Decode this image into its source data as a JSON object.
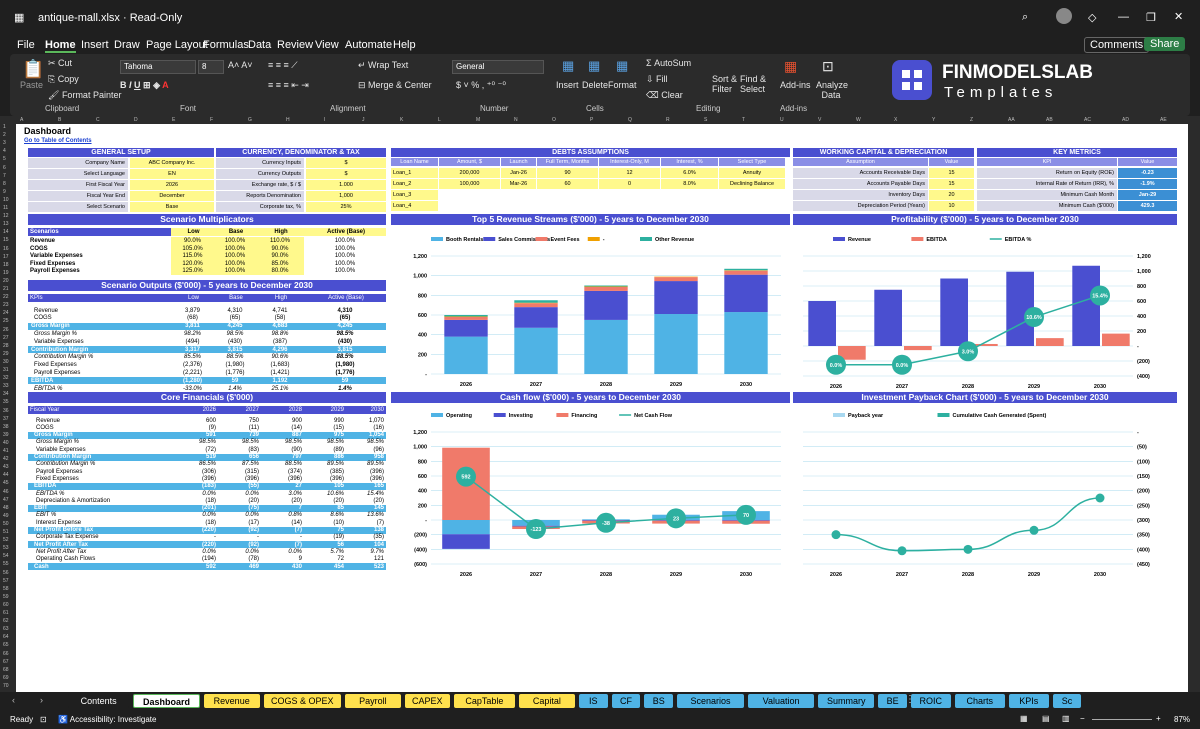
{
  "window": {
    "title": "antique-mall.xlsx  ·  Read-Only",
    "zoom": "87%",
    "status": "Ready",
    "accessibility": "Accessibility: Investigate"
  },
  "menu": [
    "File",
    "Home",
    "Insert",
    "Draw",
    "Page Layout",
    "Formulas",
    "Data",
    "Review",
    "View",
    "Automate",
    "Help"
  ],
  "comments": "Comments",
  "share": "Share",
  "ribbon": {
    "paste": "Paste",
    "cut": "Cut",
    "copy": "Copy",
    "format_painter": "Format Painter",
    "clipboard": "Clipboard",
    "font_name": "Tahoma",
    "font_size": "8",
    "font": "Font",
    "wrap_text": "Wrap Text",
    "merge_center": "Merge & Center",
    "alignment": "Alignment",
    "number_format": "General",
    "number": "Number",
    "insert": "Insert",
    "delete": "Delete",
    "format": "Format",
    "cells": "Cells",
    "autosum": "AutoSum",
    "fill": "Fill",
    "clear": "Clear",
    "sort_filter": "Sort & Filter",
    "find_select": "Find & Select",
    "editing": "Editing",
    "addins": "Add-ins",
    "analyze": "Analyze Data",
    "addins_group": "Add-ins",
    "logo_top": "FINMODELSLAB",
    "logo_bottom": "Templates"
  },
  "columns": [
    "A",
    "B",
    "C",
    "D",
    "E",
    "F",
    "G",
    "H",
    "I",
    "J",
    "K",
    "L",
    "M",
    "N",
    "O",
    "P",
    "Q",
    "R",
    "S",
    "T",
    "U",
    "V",
    "W",
    "X",
    "Y",
    "Z",
    "AA",
    "AB",
    "AC",
    "AD",
    "AE"
  ],
  "sheet": {
    "title": "Dashboard",
    "toc": "Go to Table of Contents"
  },
  "general": {
    "header": "GENERAL SETUP",
    "rows": [
      [
        "Company Name",
        "ABC Company Inc."
      ],
      [
        "Select Language",
        "EN"
      ],
      [
        "First Fiscal Year",
        "2026"
      ],
      [
        "Fiscal Year End",
        "December"
      ],
      [
        "Select Scenario",
        "Base"
      ]
    ]
  },
  "currency": {
    "header": "CURRENCY, DENOMINATOR & TAX",
    "rows": [
      [
        "Currency Inputs",
        "$"
      ],
      [
        "Currency Outputs",
        "$"
      ],
      [
        "Exchange rate, $ / $",
        "1.000"
      ],
      [
        "Reports Denomination",
        "1,000"
      ],
      [
        "Corporate tax, %",
        "25%"
      ]
    ]
  },
  "debts": {
    "header": "DEBTS ASSUMPTIONS",
    "cols": [
      "Loan Name",
      "Amount, $",
      "Launch",
      "Full Term, Months",
      "Interest-Only, M",
      "Interest, %",
      "Select Type"
    ],
    "rows": [
      [
        "Loan_1",
        "200,000",
        "Jan-26",
        "90",
        "12",
        "6.0%",
        "Annuity"
      ],
      [
        "Loan_2",
        "100,000",
        "Mar-26",
        "60",
        "0",
        "8.0%",
        "Declining Balance"
      ],
      [
        "Loan_3",
        "",
        "",
        "",
        "",
        "",
        ""
      ],
      [
        "Loan_4",
        "",
        "",
        "",
        "",
        "",
        ""
      ]
    ]
  },
  "wc": {
    "header": "WORKING CAPITAL & DEPRECIATION",
    "cols": [
      "Assumption",
      "Value"
    ],
    "rows": [
      [
        "Accounts Receivable Days",
        "15"
      ],
      [
        "Accounts Payable Days",
        "15"
      ],
      [
        "Inventory Days",
        "20"
      ],
      [
        "Depreciation Period (Years)",
        "10"
      ]
    ]
  },
  "kpi": {
    "header": "KEY METRICS",
    "cols": [
      "KPI",
      "Value"
    ],
    "rows": [
      [
        "Return on Equity (ROE)",
        "-0.23"
      ],
      [
        "Internal Rate of Return (IRR), %",
        "-1.9%"
      ],
      [
        "Minimum Cash Month",
        "Jan-29"
      ],
      [
        "Minimum Cash ($'000)",
        "429.3"
      ]
    ]
  },
  "scen_mult": {
    "header": "Scenario Multiplicators",
    "cols": [
      "Scenarios",
      "Low",
      "Base",
      "High",
      "Active (Base)"
    ],
    "rows": [
      [
        "Revenue",
        "90.0%",
        "100.0%",
        "110.0%",
        "100.0%"
      ],
      [
        "COGS",
        "105.0%",
        "100.0%",
        "90.0%",
        "100.0%"
      ],
      [
        "Variable Expenses",
        "115.0%",
        "100.0%",
        "90.0%",
        "100.0%"
      ],
      [
        "Fixed Expenses",
        "120.0%",
        "100.0%",
        "85.0%",
        "100.0%"
      ],
      [
        "Payroll Expenses",
        "125.0%",
        "100.0%",
        "80.0%",
        "100.0%"
      ]
    ]
  },
  "scen_out": {
    "header": "Scenario Outputs ($'000) - 5 years to December 2030",
    "cols": [
      "KPIs",
      "Low",
      "Base",
      "High",
      "Active (Base)"
    ],
    "rows": [
      [
        "Revenue",
        "3,879",
        "4,310",
        "4,741",
        "4,310",
        "n"
      ],
      [
        "COGS",
        "(68)",
        "(65)",
        "(58)",
        "(65)",
        "n"
      ],
      [
        "Gross Margin",
        "3,811",
        "4,245",
        "4,683",
        "4,245",
        "b"
      ],
      [
        "Gross Margin %",
        "98.2%",
        "98.5%",
        "98.8%",
        "98.5%",
        "i"
      ],
      [
        "Variable Expenses",
        "(494)",
        "(430)",
        "(387)",
        "(430)",
        "n"
      ],
      [
        "Contribution Margin",
        "3,317",
        "3,815",
        "4,296",
        "3,815",
        "b"
      ],
      [
        "Contribution Margin %",
        "85.5%",
        "88.5%",
        "90.6%",
        "88.5%",
        "i"
      ],
      [
        "Fixed Expenses",
        "(2,376)",
        "(1,980)",
        "(1,683)",
        "(1,980)",
        "n"
      ],
      [
        "Payroll Expenses",
        "(2,221)",
        "(1,776)",
        "(1,421)",
        "(1,776)",
        "n"
      ],
      [
        "EBITDA",
        "(1,280)",
        "59",
        "1,192",
        "59",
        "b"
      ],
      [
        "EBITDA %",
        "-33.0%",
        "1.4%",
        "25.1%",
        "1.4%",
        "i"
      ]
    ]
  },
  "core": {
    "header": "Core Financials ($'000)",
    "cols": [
      "Fiscal Year",
      "2026",
      "2027",
      "2028",
      "2029",
      "2030"
    ],
    "rows": [
      [
        "Revenue",
        "600",
        "750",
        "900",
        "990",
        "1,070",
        "n"
      ],
      [
        "COGS",
        "(9)",
        "(11)",
        "(14)",
        "(15)",
        "(16)",
        "n"
      ],
      [
        "Gross Margin",
        "591",
        "739",
        "887",
        "975",
        "1,054",
        "b"
      ],
      [
        "Gross Margin %",
        "98.5%",
        "98.5%",
        "98.5%",
        "98.5%",
        "98.5%",
        "i"
      ],
      [
        "Variable Expenses",
        "(72)",
        "(83)",
        "(90)",
        "(89)",
        "(96)",
        "n"
      ],
      [
        "Contribution Margin",
        "519",
        "656",
        "797",
        "886",
        "958",
        "b"
      ],
      [
        "Contribution Margin %",
        "86.5%",
        "87.5%",
        "88.5%",
        "89.5%",
        "89.5%",
        "i"
      ],
      [
        "Payroll Expenses",
        "(306)",
        "(315)",
        "(374)",
        "(385)",
        "(396)",
        "n"
      ],
      [
        "Fixed Expenses",
        "(396)",
        "(396)",
        "(396)",
        "(396)",
        "(396)",
        "n"
      ],
      [
        "EBITDA",
        "(183)",
        "(55)",
        "27",
        "105",
        "165",
        "b"
      ],
      [
        "EBITDA %",
        "0.0%",
        "0.0%",
        "3.0%",
        "10.6%",
        "15.4%",
        "i"
      ],
      [
        "Depreciation & Amortization",
        "(18)",
        "(20)",
        "(20)",
        "(20)",
        "(20)",
        "n"
      ],
      [
        "EBIT",
        "(201)",
        "(75)",
        "7",
        "85",
        "145",
        "b"
      ],
      [
        "EBIT %",
        "0.0%",
        "0.0%",
        "0.8%",
        "8.6%",
        "13.6%",
        "i"
      ],
      [
        "Interest Expense",
        "(18)",
        "(17)",
        "(14)",
        "(10)",
        "(7)",
        "n"
      ],
      [
        "Net Profit Before Tax",
        "(220)",
        "(92)",
        "(7)",
        "75",
        "138",
        "b"
      ],
      [
        "Corporate Tax Expense",
        "-",
        "-",
        "-",
        "(19)",
        "(35)",
        "n"
      ],
      [
        "Net Profit After Tax",
        "(220)",
        "(92)",
        "(7)",
        "56",
        "104",
        "b"
      ],
      [
        "Net Profit After Tax",
        "0.0%",
        "0.0%",
        "0.0%",
        "5.7%",
        "9.7%",
        "i"
      ],
      [
        "Operating Cash Flows",
        "(194)",
        "(78)",
        "9",
        "72",
        "121",
        "n"
      ],
      [
        "Cash",
        "592",
        "469",
        "430",
        "454",
        "523",
        "b"
      ]
    ]
  },
  "chart_titles": {
    "revenue": "Top 5 Revenue Streams ($'000) - 5 years to December 2030",
    "profit": "Profitability ($'000) - 5 years to December 2030",
    "cashflow": "Cash flow ($'000) - 5 years to December 2030",
    "payback": "Investment Payback Chart ($'000) - 5 years to December 2030"
  },
  "chart_data": [
    {
      "type": "bar",
      "id": "revenue",
      "stacked": true,
      "categories": [
        "2026",
        "2027",
        "2028",
        "2029",
        "2030"
      ],
      "ylim": [
        0,
        1200
      ],
      "yticks": [
        "-",
        "200",
        "400",
        "600",
        "800",
        "1,000",
        "1,200"
      ],
      "series": [
        {
          "name": "Booth Rentals",
          "color": "#4fb3e5",
          "values": [
            380,
            470,
            550,
            610,
            630
          ]
        },
        {
          "name": "Sales Commissions",
          "color": "#4a4fd0",
          "values": [
            170,
            210,
            295,
            335,
            380
          ]
        },
        {
          "name": "Event Fees",
          "color": "#f07a6a",
          "values": [
            30,
            40,
            40,
            40,
            40
          ]
        },
        {
          "name": "-",
          "color": "#f0a000",
          "values": [
            5,
            5,
            5,
            5,
            5
          ]
        },
        {
          "name": "Other Revenue",
          "color": "#2db0a0",
          "values": [
            15,
            25,
            10,
            0,
            15
          ]
        }
      ]
    },
    {
      "type": "bar",
      "id": "profit",
      "categories": [
        "2026",
        "2027",
        "2028",
        "2029",
        "2030"
      ],
      "ylim": [
        -400,
        1200
      ],
      "y2lim": [
        -400,
        1200
      ],
      "yticks_right": [
        "(400)",
        "(200)",
        "-",
        "200",
        "400",
        "600",
        "800",
        "1,000",
        "1,200"
      ],
      "series": [
        {
          "name": "Revenue",
          "color": "#4a4fd0",
          "values": [
            600,
            750,
            900,
            990,
            1070
          ]
        },
        {
          "name": "EBITDA",
          "color": "#f07a6a",
          "values": [
            -183,
            -55,
            27,
            105,
            165
          ]
        },
        {
          "name": "EBITDA %",
          "color": "#2db0a0",
          "type": "line",
          "values": [
            0.0,
            0.0,
            3.0,
            10.6,
            15.4
          ],
          "labels": [
            "0.0%",
            "0.0%",
            "3.0%",
            "10.6%",
            "15.4%"
          ]
        }
      ]
    },
    {
      "type": "bar",
      "id": "cashflow",
      "stacked": true,
      "categories": [
        "2026",
        "2027",
        "2028",
        "2029",
        "2030"
      ],
      "ylim": [
        -600,
        1200
      ],
      "yticks": [
        "(600)",
        "(400)",
        "(200)",
        "-",
        "200",
        "400",
        "600",
        "800",
        "1,000",
        "1,200"
      ],
      "series": [
        {
          "name": "Operating",
          "color": "#4fb3e5",
          "values": [
            -194,
            -78,
            9,
            72,
            121
          ]
        },
        {
          "name": "Investing",
          "color": "#4a4fd0",
          "values": [
            -200,
            -10,
            -10,
            -10,
            -10
          ]
        },
        {
          "name": "Financing",
          "color": "#f07a6a",
          "values": [
            986,
            -35,
            -38,
            -39,
            -41
          ]
        },
        {
          "name": "Net Cash Flow",
          "color": "#2db0a0",
          "type": "line",
          "values": [
            592,
            -123,
            -38,
            23,
            70
          ]
        }
      ]
    },
    {
      "type": "line",
      "id": "payback",
      "categories": [
        "2026",
        "2027",
        "2028",
        "2029",
        "2030"
      ],
      "ylim": [
        -450,
        0
      ],
      "yticks": [
        "(450)",
        "(400)",
        "(350)",
        "(300)",
        "(250)",
        "(200)",
        "(150)",
        "(100)",
        "(50)",
        "-"
      ],
      "series": [
        {
          "name": "Payback year",
          "color": "#a8d8f0",
          "values": [
            0,
            0,
            0,
            0,
            0
          ]
        },
        {
          "name": "Cumulative Cash Generated (Spent)",
          "color": "#2db0a0",
          "values": [
            -350,
            -405,
            -400,
            -335,
            -225
          ]
        }
      ]
    }
  ],
  "tabs": [
    {
      "label": "Contents",
      "bg": "#1f1f1f",
      "fg": "#ffffff"
    },
    {
      "label": "Dashboard",
      "bg": "#ffffff",
      "fg": "#000000",
      "active": true
    },
    {
      "label": "Revenue",
      "bg": "#ffe14d"
    },
    {
      "label": "COGS & OPEX",
      "bg": "#ffe14d"
    },
    {
      "label": "Payroll",
      "bg": "#ffe14d"
    },
    {
      "label": "CAPEX",
      "bg": "#ffe14d"
    },
    {
      "label": "CapTable",
      "bg": "#ffe14d"
    },
    {
      "label": "Capital",
      "bg": "#ffe14d"
    },
    {
      "label": "IS",
      "bg": "#4fb3e5"
    },
    {
      "label": "CF",
      "bg": "#4fb3e5"
    },
    {
      "label": "BS",
      "bg": "#4fb3e5"
    },
    {
      "label": "Scenarios",
      "bg": "#4fb3e5"
    },
    {
      "label": "Valuation",
      "bg": "#4fb3e5"
    },
    {
      "label": "Summary",
      "bg": "#4fb3e5"
    },
    {
      "label": "BE",
      "bg": "#4fb3e5"
    },
    {
      "label": "ROIC",
      "bg": "#4fb3e5"
    },
    {
      "label": "Charts",
      "bg": "#4fb3e5"
    },
    {
      "label": "KPIs",
      "bg": "#4fb3e5"
    },
    {
      "label": "Sc",
      "bg": "#4fb3e5"
    }
  ]
}
